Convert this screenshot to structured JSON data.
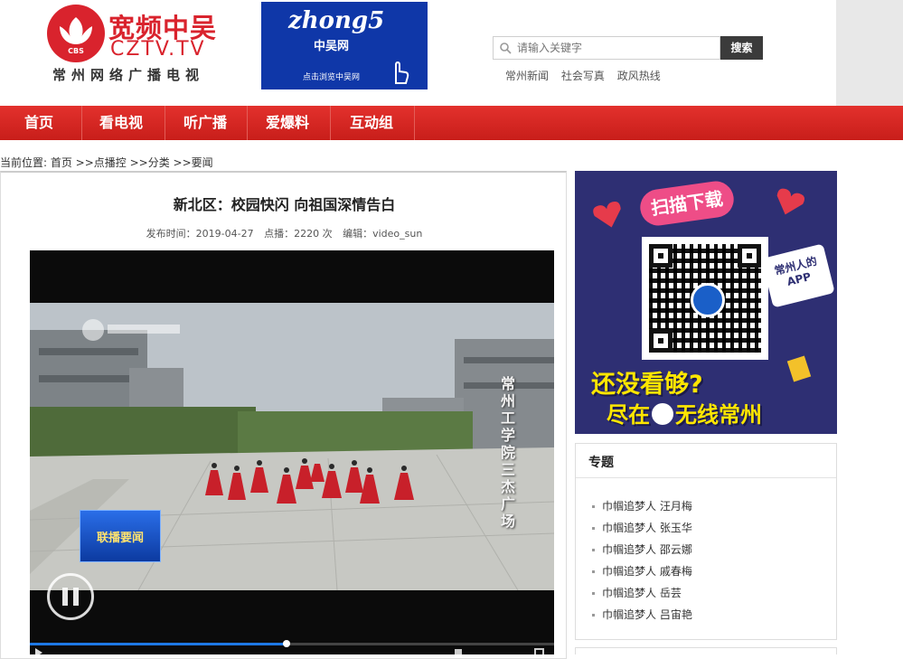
{
  "header": {
    "logo_cn": "宽频中吴",
    "logo_en": "CZTV.TV",
    "logo_sub": "常州网络广播电视",
    "logo_badge": "CBS",
    "banner": {
      "script": "zhong5",
      "name": "中吴网",
      "cta": "点击浏览中吴网"
    },
    "search": {
      "placeholder": "请输入关键字",
      "button": "搜索"
    },
    "hot_links": [
      "常州新闻",
      "社会写真",
      "政风热线"
    ]
  },
  "nav": {
    "items": [
      "首页",
      "看电视",
      "听广播",
      "爱爆料",
      "互动组"
    ]
  },
  "breadcrumb": "当前位置: 首页 >>点播控 >>分类 >>要闻",
  "article": {
    "title": "新北区：校园快闪  向祖国深情告白",
    "meta": {
      "published": "发布时间：2019-04-27",
      "plays": "点播：2220  次",
      "editor": "编辑：video_sun"
    }
  },
  "video": {
    "caption_vertical": "常州工学院三杰广场",
    "lower_third": "联播要闻",
    "progress": 0.49,
    "state": "paused",
    "colors": {
      "progress": "#1e78e6"
    }
  },
  "sidebar": {
    "app_ad": {
      "tag": "扫描下载",
      "bubble": "常州人的APP",
      "question": "还没看够?",
      "footer_left": "尽在",
      "footer_right": "无线常州"
    },
    "topics": {
      "title": "专题",
      "items": [
        "巾帼追梦人  汪月梅",
        "巾帼追梦人  张玉华",
        "巾帼追梦人  邵云娜",
        "巾帼追梦人  戚春梅",
        "巾帼追梦人  岳芸",
        "巾帼追梦人  吕宙艳"
      ]
    }
  },
  "colors": {
    "brand_red": "#d9232d",
    "nav_red": "#d4261f",
    "banner_blue": "#0f37a8",
    "ad_navy": "#2e2f73",
    "ad_yellow": "#ffe600"
  }
}
